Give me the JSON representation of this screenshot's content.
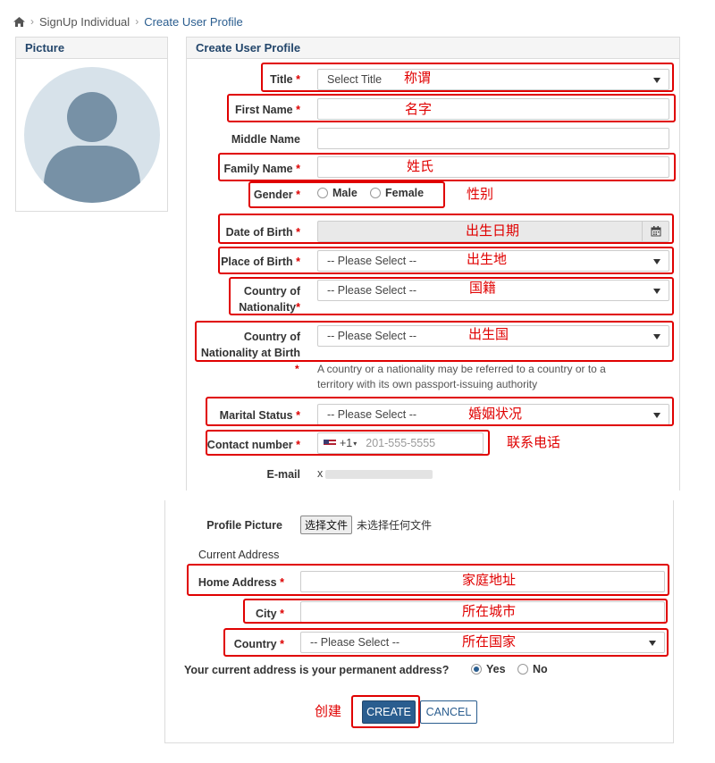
{
  "breadcrumb": {
    "items": [
      "SignUp Individual",
      "Create User Profile"
    ]
  },
  "picture_panel": {
    "title": "Picture"
  },
  "form_panel": {
    "title": "Create User Profile"
  },
  "form": {
    "title": {
      "label": "Title",
      "value": "Select Title",
      "note": "称谓"
    },
    "first_name": {
      "label": "First Name",
      "value": "",
      "note": "名字"
    },
    "middle_name": {
      "label": "Middle Name",
      "value": ""
    },
    "family_name": {
      "label": "Family Name",
      "value": "",
      "note": "姓氏"
    },
    "gender": {
      "label": "Gender",
      "options": [
        "Male",
        "Female"
      ],
      "note": "性别"
    },
    "dob": {
      "label": "Date of Birth",
      "value": "",
      "note": "出生日期"
    },
    "place_of_birth": {
      "label": "Place of Birth",
      "value": "-- Please Select --",
      "note": "出生地"
    },
    "nationality": {
      "label_line1": "Country of",
      "label_line2": "Nationality",
      "value": "-- Please Select --",
      "note": "国籍"
    },
    "nationality_birth": {
      "label_line1": "Country of",
      "label_line2": "Nationality at Birth",
      "value": "-- Please Select --",
      "note": "出生国",
      "help_line1": "A country or a nationality may be referred to a country or to a",
      "help_line2": "territory with its own passport-issuing authority"
    },
    "marital": {
      "label": "Marital Status",
      "value": "-- Please Select --",
      "note": "婚姻状况"
    },
    "contact": {
      "label": "Contact number",
      "dial_code": "+1",
      "placeholder": "201-555-5555",
      "note": "联系电话"
    },
    "email": {
      "label": "E-mail",
      "value": "x"
    },
    "required_mark": "*"
  },
  "form2": {
    "profile_picture": {
      "label": "Profile Picture",
      "button": "选择文件",
      "status": "未选择任何文件"
    },
    "current_address": {
      "heading": "Current Address"
    },
    "home_address": {
      "label": "Home Address",
      "value": "",
      "note": "家庭地址"
    },
    "city": {
      "label": "City",
      "value": "",
      "note": "所在城市"
    },
    "country": {
      "label": "Country",
      "value": "-- Please Select --",
      "note": "所在国家"
    },
    "permanent": {
      "question": "Your current address is your permanent address?",
      "options": [
        "Yes",
        "No"
      ],
      "selected": "Yes"
    },
    "actions": {
      "create": "CREATE",
      "cancel": "CANCEL",
      "create_note": "创建"
    }
  }
}
